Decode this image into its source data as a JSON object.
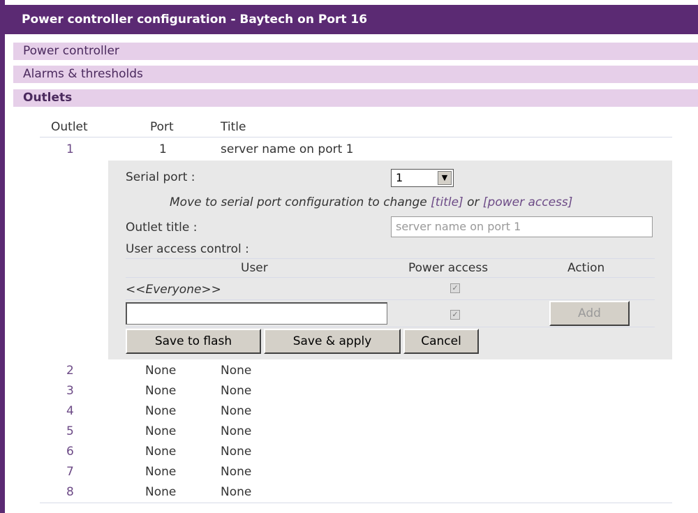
{
  "window": {
    "title": "Power controller configuration - Baytech on Port 16"
  },
  "sections": {
    "power_controller": "Power controller",
    "alarms": "Alarms & thresholds",
    "outlets": "Outlets"
  },
  "outlets_table": {
    "headers": {
      "outlet": "Outlet",
      "port": "Port",
      "title": "Title"
    },
    "rows": [
      {
        "outlet": "1",
        "port": "1",
        "title": "server name on port 1"
      },
      {
        "outlet": "2",
        "port": "None",
        "title": "None"
      },
      {
        "outlet": "3",
        "port": "None",
        "title": "None"
      },
      {
        "outlet": "4",
        "port": "None",
        "title": "None"
      },
      {
        "outlet": "5",
        "port": "None",
        "title": "None"
      },
      {
        "outlet": "6",
        "port": "None",
        "title": "None"
      },
      {
        "outlet": "7",
        "port": "None",
        "title": "None"
      },
      {
        "outlet": "8",
        "port": "None",
        "title": "None"
      }
    ]
  },
  "panel": {
    "serial_port_label": "Serial port :",
    "serial_port_value": "1",
    "note_prefix": "Move to serial port configuration to change ",
    "note_title_link": "[title]",
    "note_or": " or ",
    "note_power_link": "[power access]",
    "outlet_title_label": "Outlet title :",
    "outlet_title_value": "server name on port 1",
    "user_access_label": "User access control :",
    "col_user": "User",
    "col_power_access": "Power access",
    "col_action": "Action",
    "everyone_label": "<<Everyone>>",
    "new_user_value": "",
    "add_button": "Add",
    "save_flash_button": "Save to flash",
    "save_apply_button": "Save & apply",
    "cancel_button": "Cancel"
  },
  "colors": {
    "titlebar": "#5b2a73",
    "section_bg": "#e6cfe9",
    "link": "#6c4a86",
    "panel_bg": "#e8e8e8"
  }
}
